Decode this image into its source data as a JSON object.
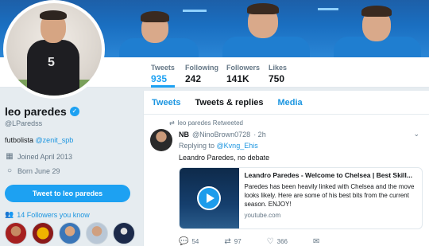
{
  "profile": {
    "name": "leo paredes",
    "handle": "@LParedss",
    "bio_text": "futbolista",
    "bio_mention": "@zenit_spb",
    "joined": "Joined April 2013",
    "born": "Born June 29",
    "tweet_to_button": "Tweet to leo paredes",
    "followers_you_know": "14 Followers you know"
  },
  "stats": [
    {
      "label": "Tweets",
      "value": "935"
    },
    {
      "label": "Following",
      "value": "242"
    },
    {
      "label": "Followers",
      "value": "141K"
    },
    {
      "label": "Likes",
      "value": "750"
    }
  ],
  "tabs": [
    "Tweets",
    "Tweets & replies",
    "Media"
  ],
  "tweet": {
    "retweeted_label": "leo paredes Retweeted",
    "author": "NB",
    "author_handle": "@NinoBrown0728",
    "time": "· 2h",
    "replying_prefix": "Replying to",
    "replying_mention": "@Kvng_Ehis",
    "text": "Leandro Paredes, no debate",
    "card": {
      "title": "Leandro Paredes - Welcome to Chelsea | Best Skill...",
      "description": "Paredes has been heavily linked with Chelsea and the move looks likely. Here are some of his best bits from the current season. ENJOY!",
      "url": "youtube.com"
    },
    "replies": "54",
    "retweets": "97",
    "likes": "366"
  },
  "colors": {
    "accent": "#1da1f2",
    "link": "#1b95e0"
  }
}
